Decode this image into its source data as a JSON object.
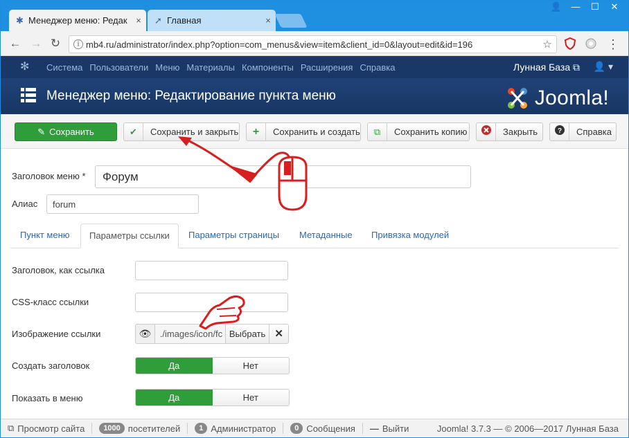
{
  "browser": {
    "tabs": [
      {
        "title": "Менеджер меню: Редак",
        "close": "×"
      },
      {
        "title": "Главная",
        "close": "×"
      }
    ],
    "window_controls": {
      "user": "👤",
      "minimize": "—",
      "maximize": "☐",
      "close": "✕"
    },
    "nav": {
      "back": "←",
      "forward": "→",
      "reload": "↻",
      "star": "☆",
      "menu": "⋮"
    },
    "url": "mb4.ru/administrator/index.php?option=com_menus&view=item&client_id=0&layout=edit&id=196"
  },
  "joomla": {
    "menu": [
      "Система",
      "Пользователи",
      "Меню",
      "Материалы",
      "Компоненты",
      "Расширения",
      "Справка"
    ],
    "site_name": "Лунная База",
    "user_icon": "👤 ▾",
    "page_title": "Менеджер меню: Редактирование пункта меню",
    "brand": "Joomla!"
  },
  "toolbar": {
    "save": "Сохранить",
    "save_close": "Сохранить и закрыть",
    "save_new": "Сохранить и создать",
    "save_copy": "Сохранить копию",
    "close": "Закрыть",
    "help": "Справка"
  },
  "form": {
    "title_label": "Заголовок меню *",
    "title_value": "Форум",
    "alias_label": "Алиас",
    "alias_value": "forum",
    "tabs": [
      "Пункт меню",
      "Параметры ссылки",
      "Параметры страницы",
      "Метаданные",
      "Привязка модулей"
    ],
    "link_title_label": "Заголовок, как ссылка",
    "css_label": "CSS-класс ссылки",
    "image_label": "Изображение ссылки",
    "image_path": "./images/icon/fc",
    "image_select": "Выбрать",
    "image_clear": "✕",
    "create_heading_label": "Создать заголовок",
    "show_in_menu_label": "Показать в меню",
    "yes": "Да",
    "no": "Нет"
  },
  "statusbar": {
    "view_site": "Просмотр сайта",
    "visitors_count": "1000",
    "visitors_label": "посетителей",
    "admin_count": "1",
    "admin_label": "Администратор",
    "messages_count": "0",
    "messages_label": "Сообщения",
    "logout": "Выйти",
    "copyright": "Joomla! 3.7.3 — © 2006—2017 Лунная База"
  },
  "colors": {
    "header_dark": "#1a3867",
    "save_green": "#2f9d3a",
    "annotation_red": "#d81e1e",
    "browser_blue": "#1f8fe0"
  }
}
